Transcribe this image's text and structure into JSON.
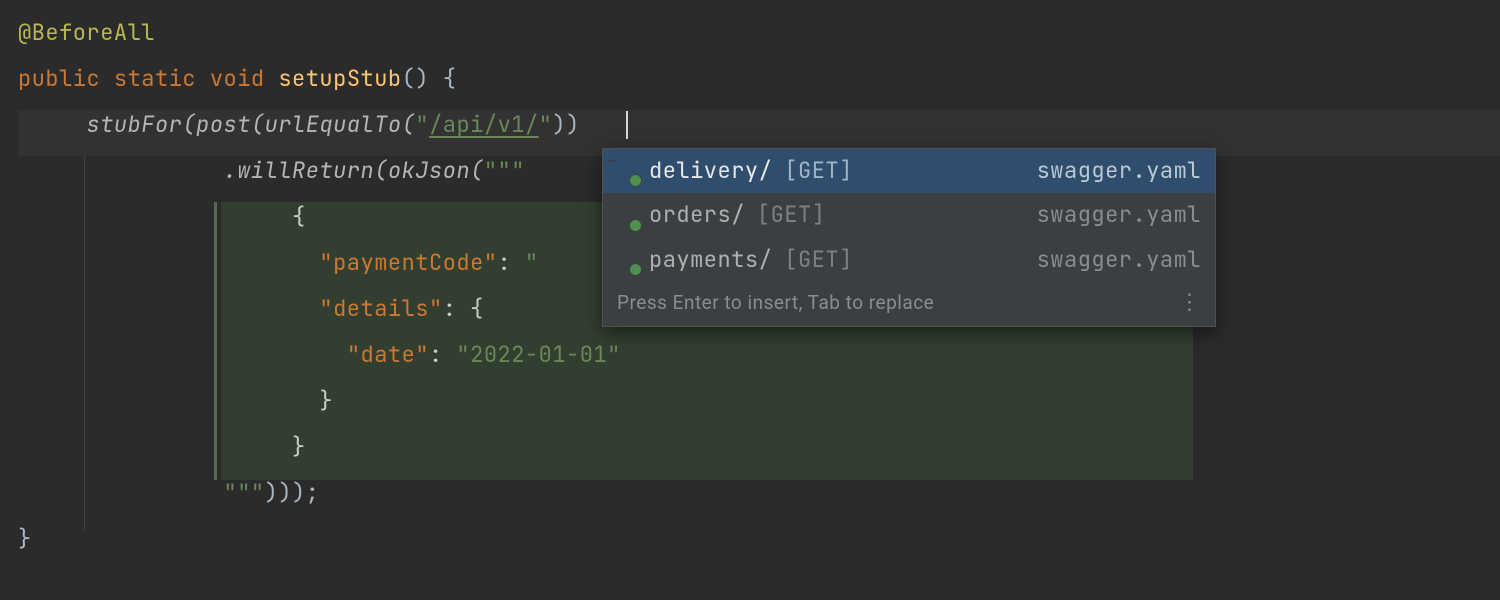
{
  "code": {
    "annotation": "@BeforeAll",
    "kw_public": "public",
    "kw_static": "static",
    "kw_void": "void",
    "methodName": "setupStub",
    "sig_tail": "() {",
    "stubFor": "stubFor",
    "post": "post",
    "urlEqualTo": "urlEqualTo",
    "urlStr_open": "\"",
    "urlStr_body": "/api/v1/",
    "urlStr_close": "\"",
    "line3_tail": "))",
    "willReturn": "willReturn",
    "okJson": "okJson",
    "tripleQuoteOpen": "\"\"\"",
    "json_open": "{",
    "json_key1": "\"paymentCode\"",
    "json_key1_colon": ": ",
    "json_key1_val_open": "\"",
    "json_key2": "\"details\"",
    "json_key2_colon": ": {",
    "json_key3": "\"date\"",
    "json_key3_colon": ": ",
    "json_key3_val": "\"2022-01-01\"",
    "json_close_inner": "}",
    "json_close_outer": "}",
    "tripleQuoteClose": "\"\"\"",
    "closeTail": ")));",
    "brace_close": "}"
  },
  "popup": {
    "items": [
      {
        "name": "delivery/",
        "method": "[GET]",
        "source": "swagger.yaml",
        "selected": true
      },
      {
        "name": "orders/",
        "method": "[GET]",
        "source": "swagger.yaml",
        "selected": false
      },
      {
        "name": "payments/",
        "method": "[GET]",
        "source": "swagger.yaml",
        "selected": false
      }
    ],
    "hint": "Press Enter to insert, Tab to replace"
  }
}
